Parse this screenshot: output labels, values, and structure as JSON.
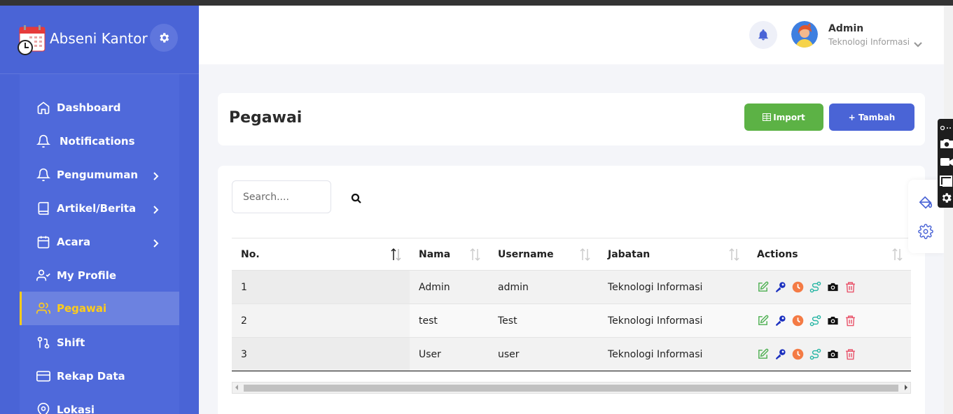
{
  "brand": {
    "name": "Abseni Kantor"
  },
  "sidebar": {
    "items": [
      {
        "label": "Dashboard",
        "icon": "home-icon",
        "has_chevron": false,
        "active": false
      },
      {
        "label": "Notifications",
        "icon": "bell-icon",
        "has_chevron": false,
        "active": false
      },
      {
        "label": "Pengumuman",
        "icon": "bell-icon",
        "has_chevron": true,
        "active": false
      },
      {
        "label": "Artikel/Berita",
        "icon": "book-icon",
        "has_chevron": true,
        "active": false
      },
      {
        "label": "Acara",
        "icon": "calendar-icon",
        "has_chevron": true,
        "active": false
      },
      {
        "label": "My Profile",
        "icon": "user-check-icon",
        "has_chevron": false,
        "active": false
      },
      {
        "label": "Pegawai",
        "icon": "users-icon",
        "has_chevron": false,
        "active": true
      },
      {
        "label": "Shift",
        "icon": "git-pull-request-icon",
        "has_chevron": false,
        "active": false
      },
      {
        "label": "Rekap Data",
        "icon": "credit-card-icon",
        "has_chevron": false,
        "active": false
      },
      {
        "label": "Lokasi",
        "icon": "map-pin-icon",
        "has_chevron": false,
        "active": false
      }
    ]
  },
  "topbar": {
    "user_name": "Admin",
    "user_dept": "Teknologi Informasi"
  },
  "header": {
    "title": "Pegawai",
    "import_label": "Import",
    "tambah_label": "+ Tambah"
  },
  "search": {
    "placeholder": "Search...."
  },
  "table": {
    "columns": [
      "No.",
      "Nama",
      "Username",
      "Jabatan",
      "Actions"
    ],
    "rows": [
      {
        "no": "1",
        "nama": "Admin",
        "username": "admin",
        "jabatan": "Teknologi Informasi"
      },
      {
        "no": "2",
        "nama": "test",
        "username": "Test",
        "jabatan": "Teknologi Informasi"
      },
      {
        "no": "3",
        "nama": "User",
        "username": "user",
        "jabatan": "Teknologi Informasi"
      }
    ]
  },
  "colors": {
    "sidebar": "#4a64d6",
    "accent_active": "#ffcc1a",
    "import_green": "#5cb245",
    "tambah_blue": "#4a64d6"
  }
}
